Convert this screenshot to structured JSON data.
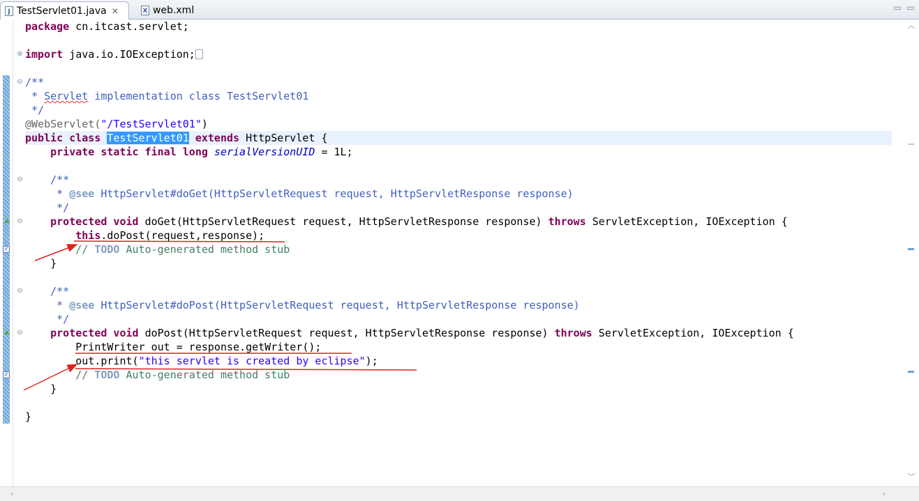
{
  "tabs": [
    {
      "label": "TestServlet01.java",
      "icon": "java-file-icon",
      "active": true,
      "close": "✕"
    },
    {
      "label": "web.xml",
      "icon": "xml-file-icon",
      "active": false
    }
  ],
  "window": {
    "minimize": "▭",
    "maximize": "▭"
  },
  "colors": {
    "keyword": "#7f0055",
    "javadoc": "#3f5fbf",
    "comment": "#3f7f5f",
    "string": "#2a00ff",
    "annotation_red": "#e02020"
  },
  "code": {
    "package_kw": "package",
    "package_rest": " cn.itcast.servlet;",
    "import_kw": "import",
    "import_rest": " java.io.IOException;",
    "jd1_open": "/**",
    "jd1_a": " * ",
    "jd1_servlet": "Servlet",
    "jd1_b": " implementation class TestServlet01",
    "jd1_close": " */",
    "annotation": "@WebServlet(",
    "annotation_str": "\"/TestServlet01\"",
    "annotation_end": ")",
    "cls_kw": "public class",
    "cls_name": "TestServlet01",
    "cls_extends": "extends",
    "cls_rest": " HttpServlet {",
    "field_kw": "private static final long",
    "field_name": "serialVersionUID",
    "field_rest": " = 1L;",
    "jd2_open": "/**",
    "jd2_star": " * ",
    "jd2_tag": "@see",
    "jd2_text": " HttpServlet#doGet(HttpServletRequest request, HttpServletResponse response)",
    "jd2_close": " */",
    "get_kw": "protected void",
    "get_sig": " doGet(HttpServletRequest request, HttpServletResponse response) ",
    "get_throws": "throws",
    "get_rest": " ServletException, IOException {",
    "get_this": "this",
    "get_call": ".doPost(request,response);",
    "get_todo_a": "// ",
    "get_todo": "TODO",
    "get_todo_b": " Auto-generated method stub",
    "get_close": "}",
    "jd3_open": "/**",
    "jd3_star": " * ",
    "jd3_tag": "@see",
    "jd3_text": " HttpServlet#doPost(HttpServletRequest request, HttpServletResponse response)",
    "jd3_close": " */",
    "post_kw": "protected void",
    "post_sig": " doPost(HttpServletRequest request, HttpServletResponse response) ",
    "post_throws": "throws",
    "post_rest": " ServletException, IOException {",
    "post_line1": "PrintWriter out = response.getWriter();",
    "post_line2_a": "out.print(",
    "post_line2_str": "\"this servlet is created by eclipse\"",
    "post_line2_b": ");",
    "post_todo_a": "// ",
    "post_todo": "TODO",
    "post_todo_b": " Auto-generated method stub",
    "post_close": "}",
    "class_close": "}"
  }
}
